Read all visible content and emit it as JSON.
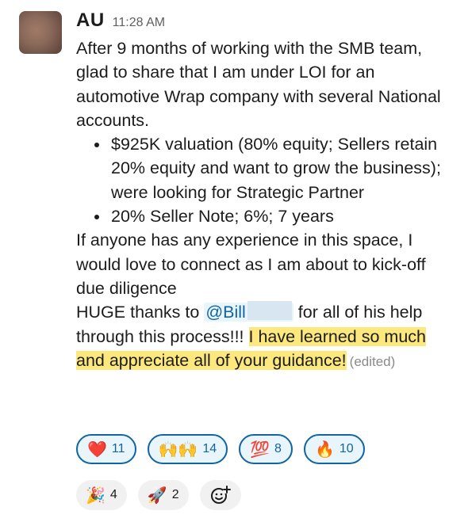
{
  "author": "AU",
  "time": "11:28 AM",
  "message": {
    "p1": "After 9 months of working with the SMB team, glad to share that I am under LOI for an automotive Wrap company with several National accounts.",
    "bullets": [
      "$925K valuation (80% equity; Sellers retain 20% equity and want to grow the business); were looking for Strategic Partner",
      "20% Seller Note; 6%; 7 years"
    ],
    "p2": "If anyone has any experience in this space, I would love to connect as I am about to kick-off due diligence",
    "p3_before": "HUGE thanks to ",
    "mention": "@Bill",
    "p3_after": " for all of his help through this process!!! ",
    "highlighted": "I have learned so much and appreciate all of your guidance!",
    "edited": "(edited)"
  },
  "reactions": [
    {
      "emoji": "❤️",
      "name": "heart",
      "count": "11"
    },
    {
      "emoji": "🙌🙌",
      "name": "raised-hands",
      "count": "14"
    },
    {
      "emoji": "💯",
      "name": "hundred",
      "count": "8"
    },
    {
      "emoji": "🔥",
      "name": "fire",
      "count": "10"
    },
    {
      "emoji": "🎉",
      "name": "party-popper",
      "count": "4"
    },
    {
      "emoji": "🚀",
      "name": "rocket",
      "count": "2"
    }
  ],
  "colors": {
    "link": "#1264a3",
    "highlight": "#fce87d",
    "reaction_active_bg": "#e8f5fa"
  }
}
